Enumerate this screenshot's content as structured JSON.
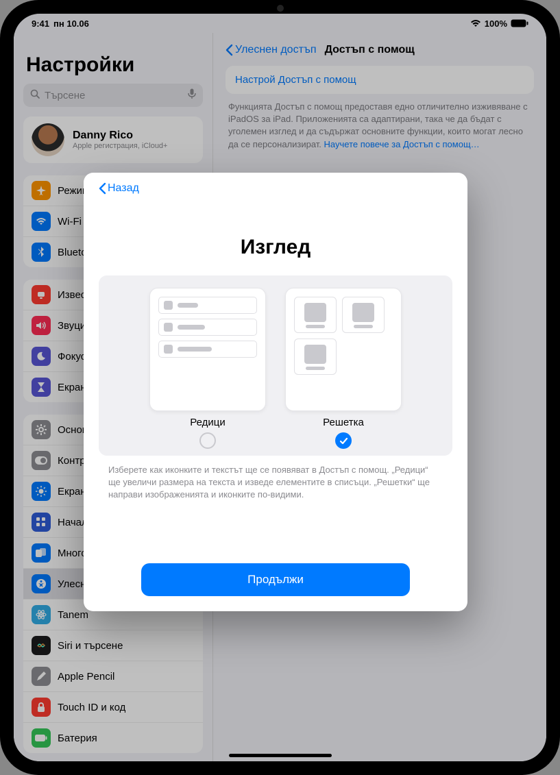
{
  "status": {
    "time": "9:41",
    "date": "пн 10.06",
    "battery": "100%"
  },
  "sidebar": {
    "title": "Настройки",
    "search_placeholder": "Търсене",
    "account": {
      "name": "Danny Rico",
      "sub": "Apple регистрация, iCloud+"
    },
    "group1": [
      {
        "label": "Режим",
        "icon": "airplane",
        "color": "#ff9500"
      },
      {
        "label": "Wi-Fi",
        "icon": "wifi",
        "color": "#007aff"
      },
      {
        "label": "Bluetooth",
        "icon": "bt",
        "color": "#007aff"
      }
    ],
    "group2": [
      {
        "label": "Известия",
        "icon": "bell",
        "color": "#ff3b30"
      },
      {
        "label": "Звуци",
        "icon": "sound",
        "color": "#ff2d55"
      },
      {
        "label": "Фокус",
        "icon": "moon",
        "color": "#5856d6"
      },
      {
        "label": "Екранно време",
        "icon": "hourglass",
        "color": "#5856d6"
      }
    ],
    "group3": [
      {
        "label": "Основни",
        "icon": "gear",
        "color": "#8e8e93"
      },
      {
        "label": "Контролен център",
        "icon": "switch",
        "color": "#8e8e93"
      },
      {
        "label": "Екран и яркост",
        "icon": "bright",
        "color": "#007aff"
      },
      {
        "label": "Начален екран и многозадачност",
        "icon": "home",
        "color": "#2f5dd8"
      },
      {
        "label": "Многозадачност",
        "icon": "multi",
        "color": "#007aff"
      },
      {
        "label": "Улеснен достъп",
        "icon": "access",
        "color": "#007aff",
        "selected": true
      },
      {
        "label": "Tanem",
        "icon": "atom",
        "color": "#32ade6"
      },
      {
        "label": "Siri и търсене",
        "icon": "siri",
        "color": "#1b1b1d"
      },
      {
        "label": "Apple Pencil",
        "icon": "pencil",
        "color": "#8e8e93"
      },
      {
        "label": "Touch ID и код",
        "icon": "lock",
        "color": "#ff3b30"
      },
      {
        "label": "Батерия",
        "icon": "batt",
        "color": "#34c759"
      }
    ]
  },
  "detail": {
    "back": "Улеснен достъп",
    "title": "Достъп с помощ",
    "card": "Настрой Достъп с помощ",
    "desc": "Функцията Достъп с помощ предоставя едно отличително изживяване с iPadOS за iPad. Приложенията са адаптирани, така че да бъдат с уголемен изглед и да съдържат основните функции, които могат лесно да се персонализират. ",
    "learn_more": "Научете повече за Достъп с помощ…"
  },
  "modal": {
    "back": "Назад",
    "title": "Изглед",
    "option_rows": "Редици",
    "option_grid": "Решетка",
    "selected": "grid",
    "desc": "Изберете как иконките и текстът ще се появяват в Достъп с помощ. „Редици“ ще увеличи размера на текста и изведе елементите в списъци. „Решетки“ ще направи изображенията и иконките по-видими.",
    "continue": "Продължи"
  }
}
